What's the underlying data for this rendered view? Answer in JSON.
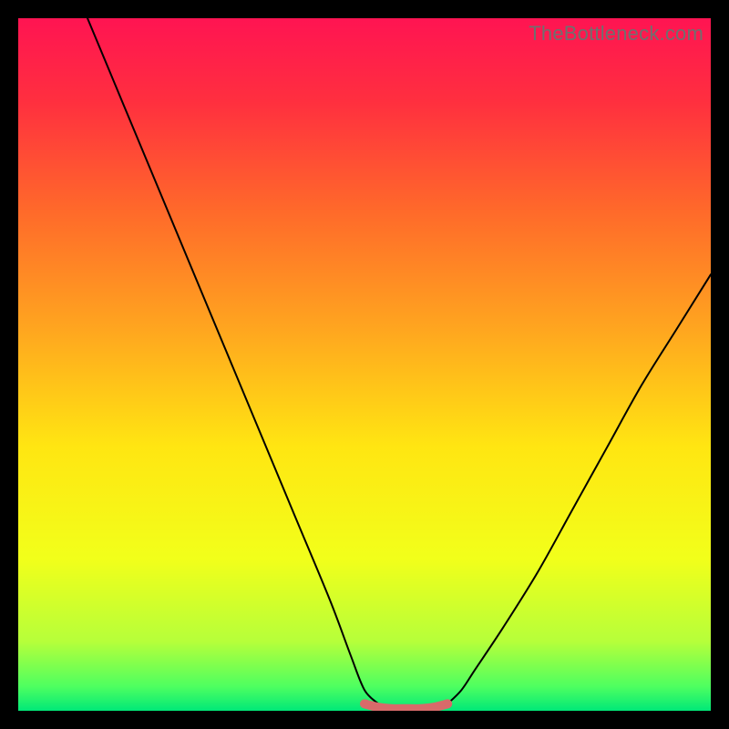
{
  "watermark": "TheBottleneck.com",
  "gradient": {
    "stops": [
      {
        "offset": 0.0,
        "color": "#ff1452"
      },
      {
        "offset": 0.12,
        "color": "#ff2f3f"
      },
      {
        "offset": 0.28,
        "color": "#ff6a2a"
      },
      {
        "offset": 0.45,
        "color": "#ffa61f"
      },
      {
        "offset": 0.62,
        "color": "#ffe612"
      },
      {
        "offset": 0.78,
        "color": "#f2ff1a"
      },
      {
        "offset": 0.9,
        "color": "#b6ff3a"
      },
      {
        "offset": 0.965,
        "color": "#4eff60"
      },
      {
        "offset": 1.0,
        "color": "#00e878"
      }
    ]
  },
  "chart_data": {
    "type": "line",
    "title": "",
    "xlabel": "",
    "ylabel": "",
    "xlim": [
      0,
      100
    ],
    "ylim": [
      0,
      100
    ],
    "series": [
      {
        "name": "left-branch",
        "x": [
          10,
          15,
          20,
          25,
          30,
          35,
          40,
          45,
          48,
          50,
          52
        ],
        "y": [
          100,
          88,
          76,
          64,
          52,
          40,
          28,
          16,
          8,
          3,
          1
        ]
      },
      {
        "name": "right-branch",
        "x": [
          62,
          64,
          66,
          70,
          75,
          80,
          85,
          90,
          95,
          100
        ],
        "y": [
          1,
          3,
          6,
          12,
          20,
          29,
          38,
          47,
          55,
          63
        ]
      },
      {
        "name": "floor-marker",
        "x": [
          50,
          52,
          54,
          56,
          58,
          60,
          62
        ],
        "y": [
          1,
          0.5,
          0.3,
          0.3,
          0.3,
          0.5,
          1
        ]
      }
    ],
    "styles": {
      "left-branch": {
        "stroke": "#000000",
        "width": 2
      },
      "right-branch": {
        "stroke": "#000000",
        "width": 2
      },
      "floor-marker": {
        "stroke": "#d86a6a",
        "width": 10
      }
    }
  }
}
